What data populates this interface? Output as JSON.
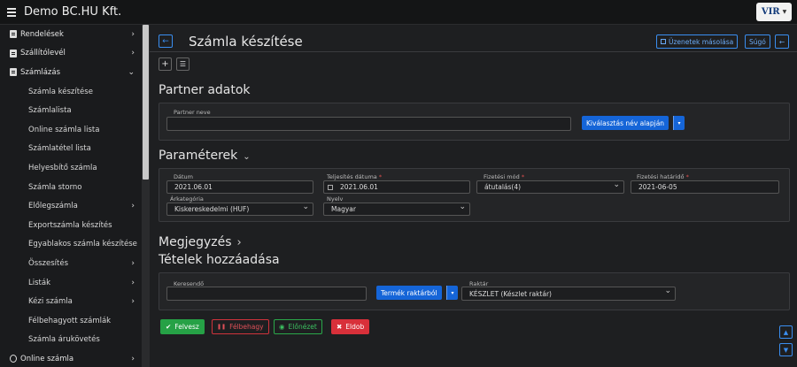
{
  "app": {
    "title": "Demo BC.HU Kft.",
    "logo_text": "VIR"
  },
  "sidebar": {
    "items": [
      {
        "label": "Rendelések",
        "level": "top",
        "icon": "document-icon",
        "chevron": "›"
      },
      {
        "label": "Szállítólevél",
        "level": "top",
        "icon": "document-icon",
        "chevron": "›"
      },
      {
        "label": "Számlázás",
        "level": "top",
        "icon": "document-icon",
        "chevron": "⌄"
      },
      {
        "label": "Számla készítése",
        "level": "sub",
        "chevron": ""
      },
      {
        "label": "Számlalista",
        "level": "sub",
        "chevron": ""
      },
      {
        "label": "Online számla lista",
        "level": "sub",
        "chevron": ""
      },
      {
        "label": "Számlatétel lista",
        "level": "sub",
        "chevron": ""
      },
      {
        "label": "Helyesbítő számla",
        "level": "sub",
        "chevron": ""
      },
      {
        "label": "Számla storno",
        "level": "sub",
        "chevron": ""
      },
      {
        "label": "Előlegszámla",
        "level": "sub",
        "chevron": "›"
      },
      {
        "label": "Exportszámla készítés",
        "level": "sub",
        "chevron": ""
      },
      {
        "label": "Egyablakos számla készítése",
        "level": "sub",
        "chevron": ""
      },
      {
        "label": "Összesítés",
        "level": "sub",
        "chevron": "›"
      },
      {
        "label": "Listák",
        "level": "sub",
        "chevron": "›"
      },
      {
        "label": "Kézi számla",
        "level": "sub",
        "chevron": "›"
      },
      {
        "label": "Félbehagyott számlák",
        "level": "sub",
        "chevron": ""
      },
      {
        "label": "Számla árukövetés",
        "level": "sub",
        "chevron": ""
      },
      {
        "label": "Online számla",
        "level": "top",
        "icon": "globe-icon",
        "chevron": "›"
      }
    ]
  },
  "header": {
    "back_icon": "←",
    "title": "Számla készítése",
    "copy_messages": "Üzenetek másolása",
    "help": "Súgó",
    "right_back_icon": "←"
  },
  "toolbar": {
    "add_icon": "+",
    "list_icon": "☰"
  },
  "partner": {
    "title": "Partner adatok",
    "name_label": "Partner neve",
    "name_value": "",
    "select_button": "Kiválasztás név alapján",
    "caret": "▾"
  },
  "params": {
    "title": "Paraméterek",
    "toggle_icon": "⌄",
    "date_label": "Dátum",
    "date_value": "2021.06.01",
    "fulfil_label": "Teljesítés dátuma",
    "fulfil_value": "2021.06.01",
    "payment_label": "Fizetési mód",
    "payment_value": "átutalás(4)",
    "deadline_label": "Fizetési határidő",
    "deadline_value": "2021-06-05",
    "price_cat_label": "Árkategória",
    "price_cat_value": "Kiskereskedelmi (HUF)",
    "lang_label": "Nyelv",
    "lang_value": "Magyar",
    "required_mark": "*"
  },
  "notes": {
    "title": "Megjegyzés",
    "arrow": "›"
  },
  "items": {
    "title": "Tételek hozzáadása",
    "search_label": "Keresendő",
    "search_value": "",
    "from_stock_button": "Termék raktárból",
    "caret": "▾",
    "warehouse_label": "Raktár",
    "warehouse_value": "KÉSZLET (Készlet raktár)"
  },
  "actions": {
    "save": "Felvesz",
    "save_icon": "✔",
    "pause": "Félbehagy",
    "pause_icon": "❚❚",
    "preview": "Előnézet",
    "preview_icon": "◉",
    "discard": "Eldob",
    "discard_icon": "✖"
  },
  "scroll": {
    "up": "▲",
    "down": "▼"
  }
}
